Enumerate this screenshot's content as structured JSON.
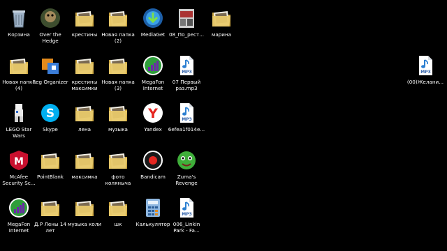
{
  "desktop": {
    "icons": [
      {
        "label": "Корзина",
        "icon": "recycle-bin-icon"
      },
      {
        "label": "Over the Hedge",
        "icon": "game-icon"
      },
      {
        "label": "крестины",
        "icon": "folder-icon"
      },
      {
        "label": "Новая папка (2)",
        "icon": "folder-icon"
      },
      {
        "label": "MediaGet",
        "icon": "mediaget-icon"
      },
      {
        "label": "08_По_рест...",
        "icon": "document-icon"
      },
      {
        "label": "марина",
        "icon": "folder-icon"
      },
      {
        "label": "Новая папка (4)",
        "icon": "folder-icon"
      },
      {
        "label": "Reg Organizer",
        "icon": "reg-organizer-icon"
      },
      {
        "label": "крестины максимки",
        "icon": "folder-icon"
      },
      {
        "label": "Новая папка (3)",
        "icon": "folder-icon"
      },
      {
        "label": "MegaFon Internet",
        "icon": "megafon-icon"
      },
      {
        "label": "07 Первый раз.mp3",
        "icon": "mp3-file-icon"
      },
      {
        "label": "LEGO Star Wars",
        "icon": "lego-star-wars-icon"
      },
      {
        "label": "Skype",
        "icon": "skype-icon"
      },
      {
        "label": "лена",
        "icon": "folder-icon"
      },
      {
        "label": "музыка",
        "icon": "folder-icon"
      },
      {
        "label": "Yandex",
        "icon": "yandex-browser-icon"
      },
      {
        "label": "6efea1f014e...",
        "icon": "mp3-file-icon"
      },
      {
        "label": "McAfee Security Sc...",
        "icon": "mcafee-icon"
      },
      {
        "label": "PointBlank",
        "icon": "folder-icon"
      },
      {
        "label": "максимка",
        "icon": "folder-icon"
      },
      {
        "label": "фото коляныча",
        "icon": "folder-icon"
      },
      {
        "label": "Bandicam",
        "icon": "bandicam-icon"
      },
      {
        "label": "Zuma's Revenge",
        "icon": "zuma-icon"
      },
      {
        "label": "MegaFon Internet",
        "icon": "megafon-icon"
      },
      {
        "label": "Д.Р Лены 14 лет",
        "icon": "folder-icon"
      },
      {
        "label": "музыка коли",
        "icon": "folder-icon"
      },
      {
        "label": "шк",
        "icon": "folder-icon"
      },
      {
        "label": "Калькулятор",
        "icon": "calculator-icon"
      },
      {
        "label": "006_Linkin Park - Fa...",
        "icon": "mp3-file-icon"
      },
      {
        "label": "(00)Желани...",
        "icon": "mp3-file-icon"
      }
    ],
    "mp3_badge": "MP3"
  },
  "colors": {
    "background": "#000000",
    "folder": "#e8c96a",
    "megafon": "#2e9e3a",
    "skype": "#00aff0",
    "yandex": "#e52620",
    "mcafee": "#c8102e"
  }
}
